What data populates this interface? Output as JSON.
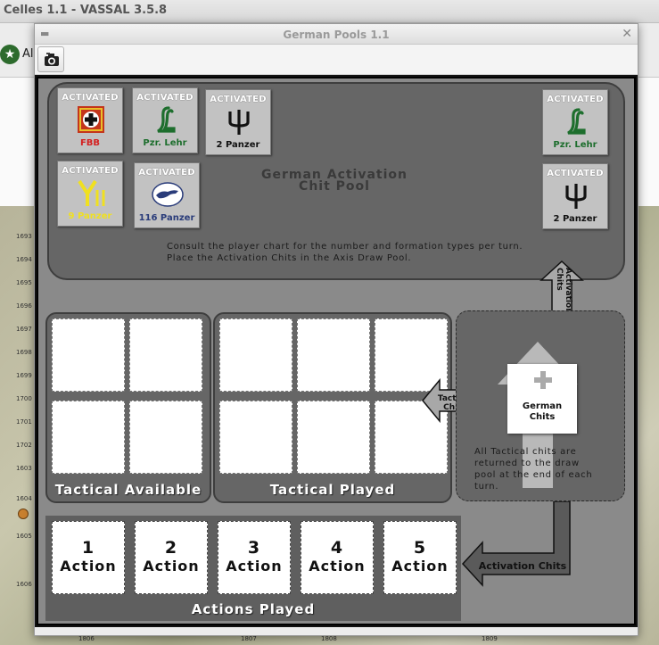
{
  "main_window": {
    "title": "Celles 1.1 - VASSAL 3.5.8",
    "toolbar_label": "Al",
    "map_hex_labels": [
      "1693",
      "1694",
      "1695",
      "1696",
      "1697",
      "1698",
      "1699",
      "1700",
      "1701",
      "1702",
      "1603",
      "1604",
      "1605",
      "1606"
    ],
    "bottom_hex_labels": [
      "1806",
      "1807",
      "1808",
      "1809"
    ]
  },
  "dialog": {
    "title": "German Pools 1.1",
    "menu_glyph": "▬",
    "close_glyph": "✕",
    "toolbar": {
      "camera_icon": "camera-icon"
    }
  },
  "activation_pool": {
    "title_line1": "German Activation",
    "title_line2": "Chit Pool",
    "instructions_line1": "Consult the player chart for the number and formation types per turn.",
    "instructions_line2": "Place the Activation Chits in the Axis Draw Pool.",
    "chits": [
      {
        "header": "ACTIVATED",
        "name": "FBB",
        "name_color": "#d42020",
        "icon": "fbb-cross-icon"
      },
      {
        "header": "ACTIVATED",
        "name": "Pzr. Lehr",
        "name_color": "#1d6e2d",
        "icon": "panzer-lehr-icon"
      },
      {
        "header": "ACTIVATED",
        "name": "2 Panzer",
        "name_color": "#111111",
        "icon": "trident-icon"
      },
      {
        "header": "ACTIVATED",
        "name": "9 Panzer",
        "name_color": "#f0e020",
        "icon": "9-panzer-icon"
      },
      {
        "header": "ACTIVATED",
        "name": "116 Panzer",
        "name_color": "#2a3c7a",
        "icon": "greyhound-icon"
      },
      {
        "header": "ACTIVATED",
        "name": "Pzr. Lehr",
        "name_color": "#1d6e2d",
        "icon": "panzer-lehr-icon"
      },
      {
        "header": "ACTIVATED",
        "name": "2 Panzer",
        "name_color": "#111111",
        "icon": "trident-icon"
      }
    ]
  },
  "tactical_available": {
    "label": "Tactical Available"
  },
  "tactical_played": {
    "label": "Tactical Played"
  },
  "draw_pool": {
    "chit_label_line1": "German",
    "chit_label_line2": "Chits",
    "note_line1": "All Tactical chits are",
    "note_line2": "returned to the draw",
    "note_line3": "pool at the end of each",
    "note_line4": "turn."
  },
  "arrows": {
    "tactical": "Tactical Chits",
    "activation_vertical": "Activation Chits",
    "activation_horizontal": "Activation Chits"
  },
  "actions_played": {
    "label": "Actions Played",
    "slots": [
      {
        "number": "1",
        "word": "Action"
      },
      {
        "number": "2",
        "word": "Action"
      },
      {
        "number": "3",
        "word": "Action"
      },
      {
        "number": "4",
        "word": "Action"
      },
      {
        "number": "5",
        "word": "Action"
      }
    ]
  }
}
